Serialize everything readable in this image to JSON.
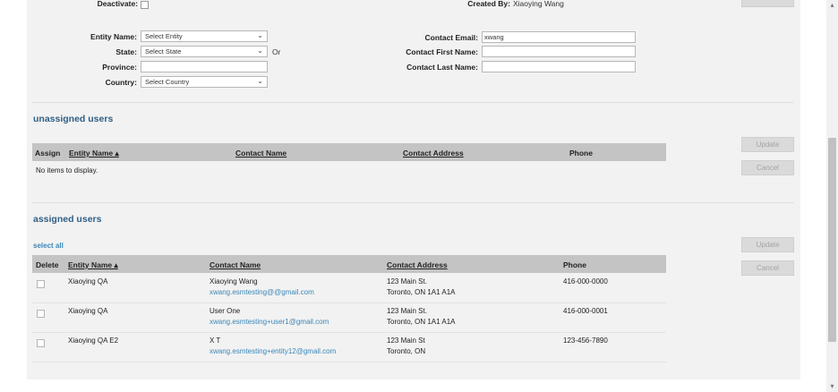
{
  "filters": {
    "deactivate_label": "Deactivate:",
    "created_by_label": "Created By:",
    "created_by_value": "Xiaoying Wang",
    "entity_name_label": "Entity Name:",
    "entity_name_value": "Select Entity",
    "state_label": "State:",
    "state_value": "Select State",
    "or_label": "Or",
    "province_label": "Province:",
    "province_value": "",
    "country_label": "Country:",
    "country_value": "Select Country",
    "contact_email_label": "Contact Email:",
    "contact_email_value": "xwang",
    "contact_first_name_label": "Contact First Name:",
    "contact_first_name_value": "",
    "contact_last_name_label": "Contact Last Name:",
    "contact_last_name_value": ""
  },
  "unassigned": {
    "title": "unassigned users",
    "columns": [
      "Assign",
      "Entity Name ▴",
      "Contact Name",
      "Contact Address",
      "Phone"
    ],
    "empty_message": "No items to display.",
    "update_label": "Update",
    "cancel_label": "Cancel"
  },
  "assigned": {
    "title": "assigned users",
    "select_all_label": "select all",
    "columns": [
      "Delete",
      "Entity Name ▴",
      "Contact Name",
      "Contact Address",
      "Phone"
    ],
    "update_label": "Update",
    "cancel_label": "Cancel",
    "rows": [
      {
        "entity": "Xiaoying QA",
        "name": "Xiaoying Wang",
        "email": "xwang.esmtesting@@gmail.com",
        "address1": "123 Main St.",
        "address2": "Toronto, ON 1A1 A1A",
        "phone": "416-000-0000"
      },
      {
        "entity": "Xiaoying QA",
        "name": "User One",
        "email": "xwang.esmtesting+user1@gmail.com",
        "address1": "123 Main St.",
        "address2": "Toronto, ON 1A1 A1A",
        "phone": "416-000-0001"
      },
      {
        "entity": "Xiaoying QA E2",
        "name": "X T",
        "email": "xwang.esmtesting+entity12@gmail.com",
        "address1": "123 Main St",
        "address2": "Toronto, ON",
        "phone": "123-456-7890"
      }
    ]
  },
  "colors": {
    "panel_bg": "#f2f2f2",
    "header_bg": "#c4c4c4",
    "title_blue": "#2f5f86",
    "link_blue": "#3a87b8"
  },
  "icons": {
    "dropdown": "chevron-down-icon",
    "sort": "sort-asc-icon",
    "scroll_up": "scroll-up-arrow-icon",
    "scroll_down": "scroll-down-arrow-icon"
  }
}
